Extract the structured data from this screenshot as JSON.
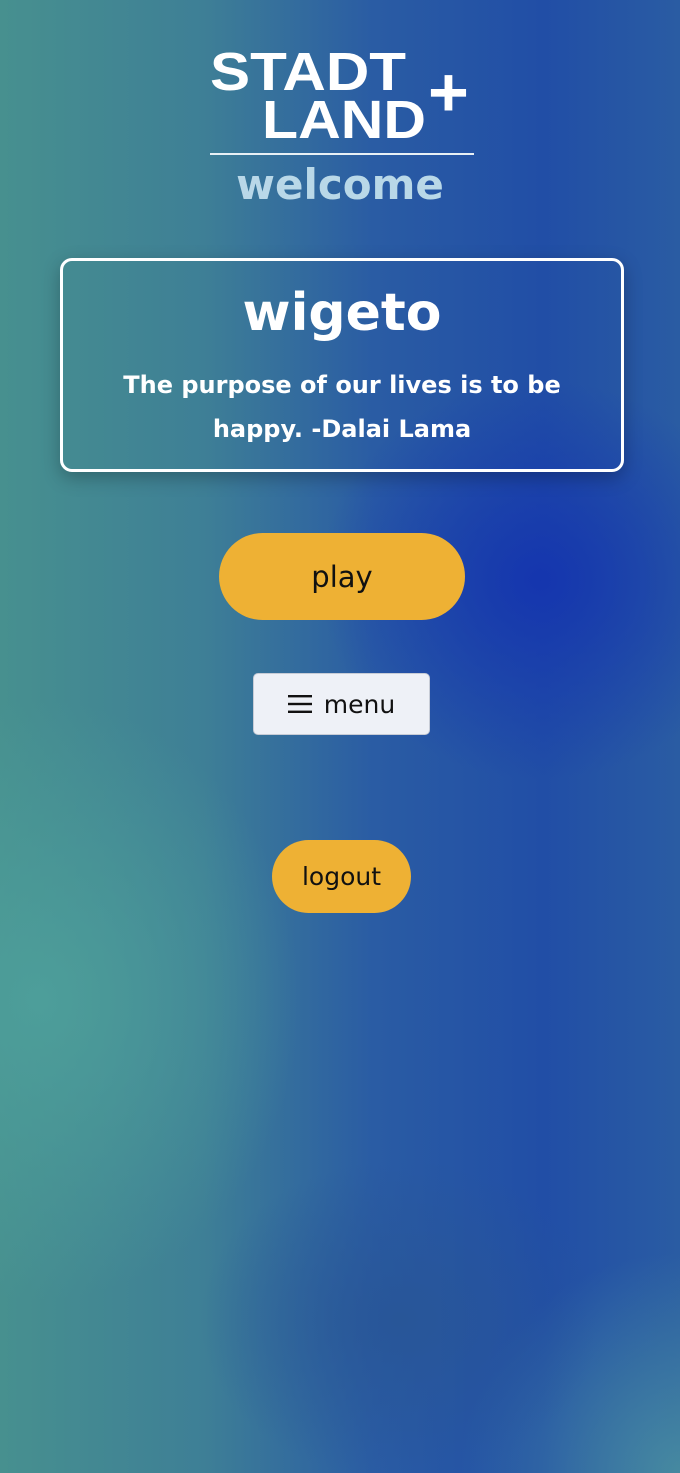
{
  "logo": {
    "line1": "STADT",
    "line2": "LAND",
    "plus": "+"
  },
  "header": {
    "welcome": "welcome"
  },
  "card": {
    "username": "wigeto",
    "quote": "The purpose of our lives is to be happy. -Dalai Lama"
  },
  "buttons": {
    "play": "play",
    "menu": "menu",
    "logout": "logout"
  },
  "icons": {
    "menu": "hamburger-icon"
  },
  "colors": {
    "accent": "#eeb134",
    "menu_bg": "#eef1f7",
    "welcome_text": "#b9d8e8",
    "card_border": "#ffffff"
  }
}
